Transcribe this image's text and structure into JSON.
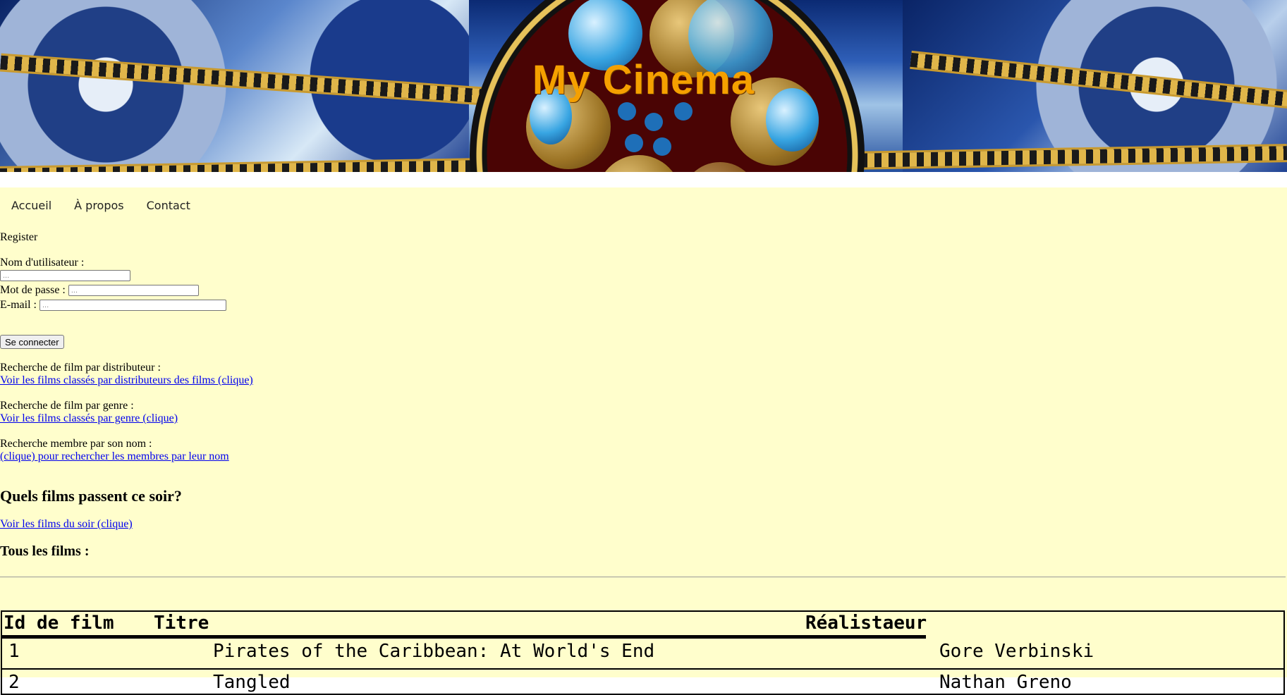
{
  "banner": {
    "title": "My Cinema"
  },
  "nav": {
    "items": [
      "Accueil",
      "À propos",
      "Contact"
    ]
  },
  "register": {
    "heading": "Register",
    "username_label": "Nom d'utilisateur :",
    "username_placeholder": "...",
    "password_label": "Mot de passe :",
    "password_placeholder": "...",
    "email_label": "E-mail :",
    "email_placeholder": "...",
    "submit_label": "Se connecter"
  },
  "searches": [
    {
      "label": "Recherche de film par distributeur :",
      "link": "Voir les films classés par distributeurs des films (clique)"
    },
    {
      "label": "Recherche de film par genre :",
      "link": "Voir les films classés par genre (clique)"
    },
    {
      "label": "Recherche membre par son nom :",
      "link": "(clique) pour rechercher les membres par leur nom"
    }
  ],
  "tonight": {
    "heading": "Quels films passent ce soir?",
    "link": "Voir les films du soir (clique)"
  },
  "all_films": {
    "heading": "Tous les films :"
  },
  "table": {
    "headers": [
      "Id de film",
      "Titre",
      "Réalistaeur"
    ],
    "rows": [
      {
        "id": "1",
        "title": "Pirates of the Caribbean: At World's End",
        "director": "Gore Verbinski"
      },
      {
        "id": "2",
        "title": "Tangled",
        "director": "Nathan Greno"
      }
    ]
  },
  "colors": {
    "page_bg": "#fffecc",
    "title": "#f5a000",
    "link": "#0000ee"
  }
}
